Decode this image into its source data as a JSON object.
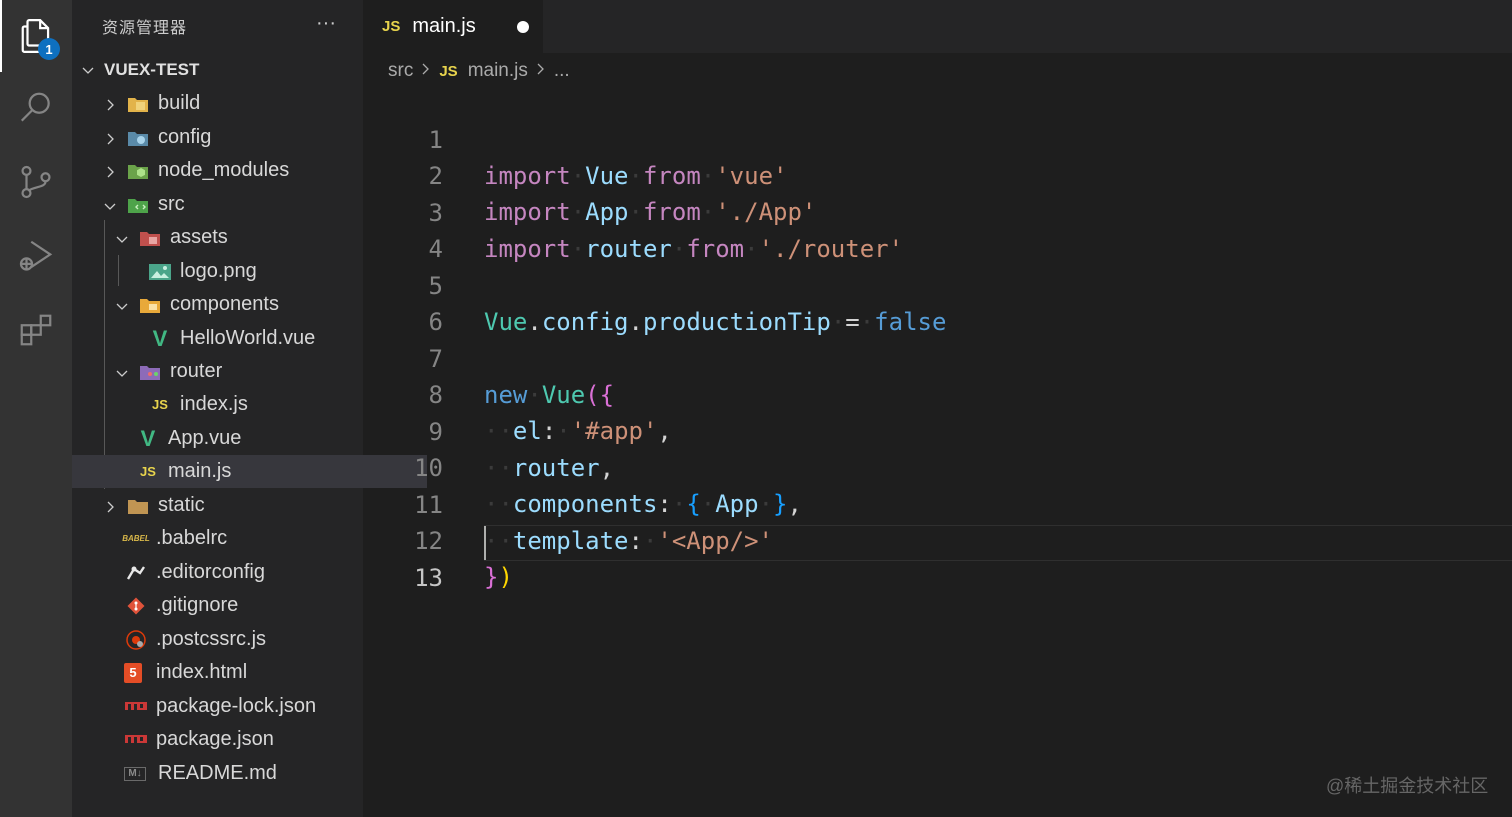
{
  "sidebar": {
    "title": "资源管理器",
    "more": "···",
    "root": "VUEX-TEST",
    "badge_count": "1",
    "items": [
      {
        "label": "build"
      },
      {
        "label": "config"
      },
      {
        "label": "node_modules"
      },
      {
        "label": "src"
      },
      {
        "label": "assets"
      },
      {
        "label": "logo.png"
      },
      {
        "label": "components"
      },
      {
        "label": "HelloWorld.vue"
      },
      {
        "label": "router"
      },
      {
        "label": "index.js"
      },
      {
        "label": "App.vue"
      },
      {
        "label": "main.js"
      },
      {
        "label": "static"
      },
      {
        "label": ".babelrc"
      },
      {
        "label": ".editorconfig"
      },
      {
        "label": ".gitignore"
      },
      {
        "label": ".postcssrc.js"
      },
      {
        "label": "index.html"
      },
      {
        "label": "package-lock.json"
      },
      {
        "label": "package.json"
      },
      {
        "label": "README.md"
      }
    ]
  },
  "tab": {
    "lang": "JS",
    "name": "main.js"
  },
  "breadcrumb": {
    "folder": "src",
    "lang": "JS",
    "file": "main.js",
    "tail": "..."
  },
  "icons": {
    "js_label": "JS",
    "vue_label": "V",
    "html_label": "5",
    "md_label": "M↓",
    "babel_label": "BABEL"
  },
  "editor": {
    "line_numbers": [
      "1",
      "2",
      "3",
      "4",
      "5",
      "6",
      "7",
      "8",
      "9",
      "10",
      "11",
      "12",
      "13"
    ],
    "current_line": "13"
  },
  "watermark": "@稀土掘金技术社区"
}
